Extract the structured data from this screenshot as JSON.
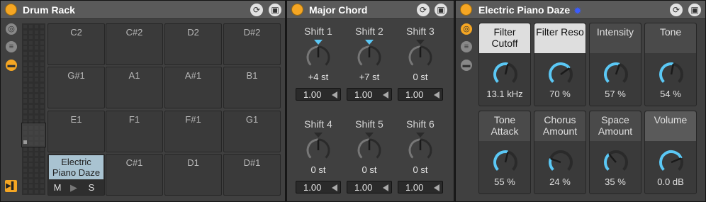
{
  "drum_rack": {
    "title": "Drum Rack",
    "pads": [
      [
        "C2",
        "C#2",
        "D2",
        "D#2"
      ],
      [
        "G#1",
        "A1",
        "A#1",
        "B1"
      ],
      [
        "E1",
        "F1",
        "F#1",
        "G1"
      ],
      [
        "Electric Piano Daze",
        "C#1",
        "D1",
        "D#1"
      ]
    ],
    "pad_buttons": {
      "mute": "M",
      "play": "▶",
      "solo": "S"
    }
  },
  "major_chord": {
    "title": "Major Chord",
    "shifts": [
      {
        "label": "Shift 1",
        "value": "+4 st",
        "velocity": "1.00"
      },
      {
        "label": "Shift 2",
        "value": "+7 st",
        "velocity": "1.00"
      },
      {
        "label": "Shift 3",
        "value": "0 st",
        "velocity": "1.00"
      },
      {
        "label": "Shift 4",
        "value": "0 st",
        "velocity": "1.00"
      },
      {
        "label": "Shift 5",
        "value": "0 st",
        "velocity": "1.00"
      },
      {
        "label": "Shift 6",
        "value": "0 st",
        "velocity": "1.00"
      }
    ]
  },
  "electric_piano": {
    "title": "Electric Piano Daze",
    "macros": [
      {
        "label": "Filter Cutoff",
        "value": "13.1 kHz",
        "selected": true
      },
      {
        "label": "Filter Reso",
        "value": "70 %",
        "selected": true
      },
      {
        "label": "Intensity",
        "value": "57 %",
        "selected": false
      },
      {
        "label": "Tone",
        "value": "54 %",
        "selected": false
      },
      {
        "label": "Tone Attack",
        "value": "55 %",
        "selected": false
      },
      {
        "label": "Chorus Amount",
        "value": "24 %",
        "selected": false
      },
      {
        "label": "Space Amount",
        "value": "35 %",
        "selected": false
      },
      {
        "label": "Volume",
        "value": "0.0 dB",
        "selected": false
      }
    ]
  },
  "colors": {
    "accent": "#f5a623",
    "knob_active": "#5bc8f5",
    "pad_selected": "#a9c3d1"
  }
}
